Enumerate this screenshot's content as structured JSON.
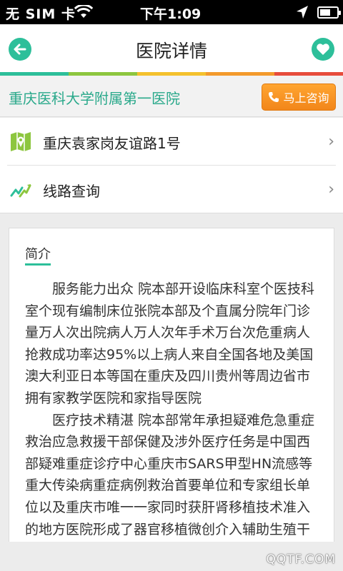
{
  "status_bar": {
    "carrier": "无 SIM 卡",
    "time": "下午1:09"
  },
  "header": {
    "title": "医院详情",
    "back_icon": "arrow-left-icon",
    "favorite_icon": "heart-icon"
  },
  "accent_colors": [
    "#2dbf9a",
    "#8dc63f",
    "#f4c12d",
    "#f39a2c",
    "#e74c3c"
  ],
  "hospital": {
    "name": "重庆医科大学附属第一医院",
    "consult_label": "马上咨询"
  },
  "list": {
    "address": "重庆袁家岗友谊路1号",
    "route": "线路查询"
  },
  "intro": {
    "heading": "简介",
    "paragraphs": [
      "服务能力出众 院本部开设临床科室个医技科室个现有编制床位张院本部及个直属分院年门诊量万人次出院病人万人次年手术万台次危重病人抢救成功率达95%以上病人来自全国各地及美国澳大利亚日本等国在重庆及四川贵州等周边省市拥有家教学医院和家指导医院",
      "医疗技术精湛 院本部常年承担疑难危急重症救治应急救援干部保健及涉外医疗任务是中国西部疑难重症诊疗中心重庆市SARS甲型HN流感等重大传染病重症病例救治首要单位和专家组长单位以及重庆市唯一一家同时获肝肾移植技术准入的地方医院形成了器官移植微创介入辅助生殖干病诊疗等优势技术在卫生部年至年“国家临"
    ]
  },
  "watermark": "QQTF.COM"
}
